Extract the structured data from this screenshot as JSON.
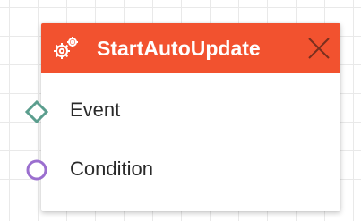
{
  "node": {
    "title": "StartAutoUpdate",
    "header_color": "#f2522f",
    "icon": "gears-icon",
    "close_icon": "close-icon",
    "ports": [
      {
        "label": "Event",
        "shape": "diamond",
        "color": "#5b9e8e"
      },
      {
        "label": "Condition",
        "shape": "circle",
        "color": "#9b6fcf"
      }
    ]
  }
}
